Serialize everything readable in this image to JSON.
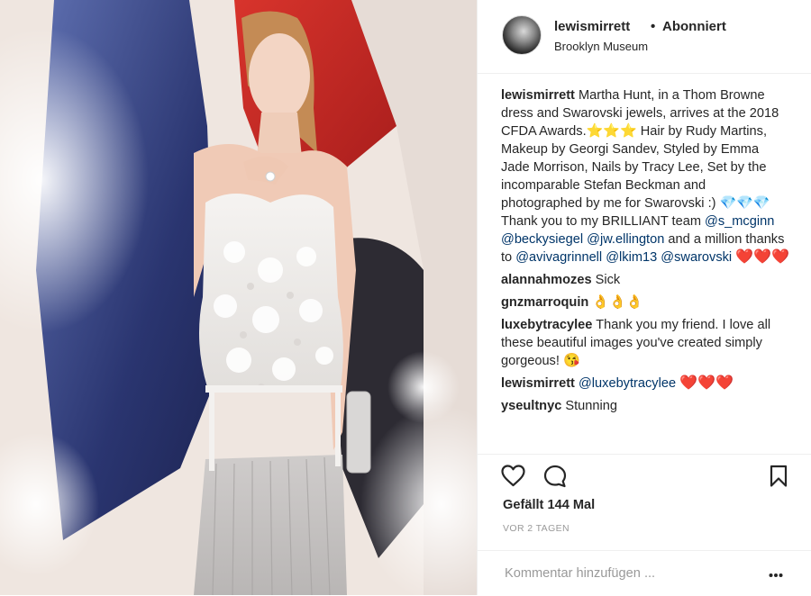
{
  "post": {
    "header": {
      "username": "lewismirrett",
      "separator": "•",
      "follow_status": "Abonniert",
      "location": "Brooklyn Museum"
    },
    "caption": {
      "username": "lewismirrett",
      "text_1": "Martha Hunt, in a Thom Browne dress and Swarovski jewels, arrives at the 2018 CFDA Awards.",
      "text_2": " Hair by Rudy Martins, Makeup by Georgi Sandev, Styled by Emma Jade Morrison, Nails by Tracy Lee, Set by the incomparable Stefan Beckman and photographed by me for Swarovski :) ",
      "text_3": " Thank you to my BRILLIANT team ",
      "mention_1": "@s_mcginn",
      "mention_2": "@beckysiegel",
      "mention_3": "@jw.ellington",
      "text_4": " and a million thanks to ",
      "mention_4": "@avivagrinnell",
      "mention_5": "@lkim13",
      "mention_6": "@swarovski",
      "stars": "⭐⭐⭐",
      "diamonds": "💎💎💎",
      "hearts": "❤️❤️❤️"
    },
    "comments": [
      {
        "username": "alannahmozes",
        "text": "Sick"
      },
      {
        "username": "gnzmarroquin",
        "text": "👌👌👌"
      },
      {
        "username": "luxebytracylee",
        "text": "Thank you my friend. I love all these beautiful images you've created simply gorgeous! ",
        "emoji": "😘"
      },
      {
        "username": "lewismirrett",
        "mention": "@luxebytracylee",
        "emoji": "❤️❤️❤️"
      },
      {
        "username": "yseultnyc",
        "text": "Stunning"
      }
    ],
    "actions": {
      "like_icon": "heart-outline-icon",
      "comment_icon": "speech-bubble-icon",
      "save_icon": "bookmark-icon",
      "likes": "Gefällt 144 Mal",
      "timestamp": "VOR 2 TAGEN"
    },
    "comment_box": {
      "placeholder": "Kommentar hinzufügen ...",
      "more_icon": "more-dots-icon"
    }
  },
  "colors": {
    "text": "#262626",
    "mention": "#003569",
    "secondary": "#999999",
    "border": "#efefef",
    "heart": "#e0191e"
  }
}
